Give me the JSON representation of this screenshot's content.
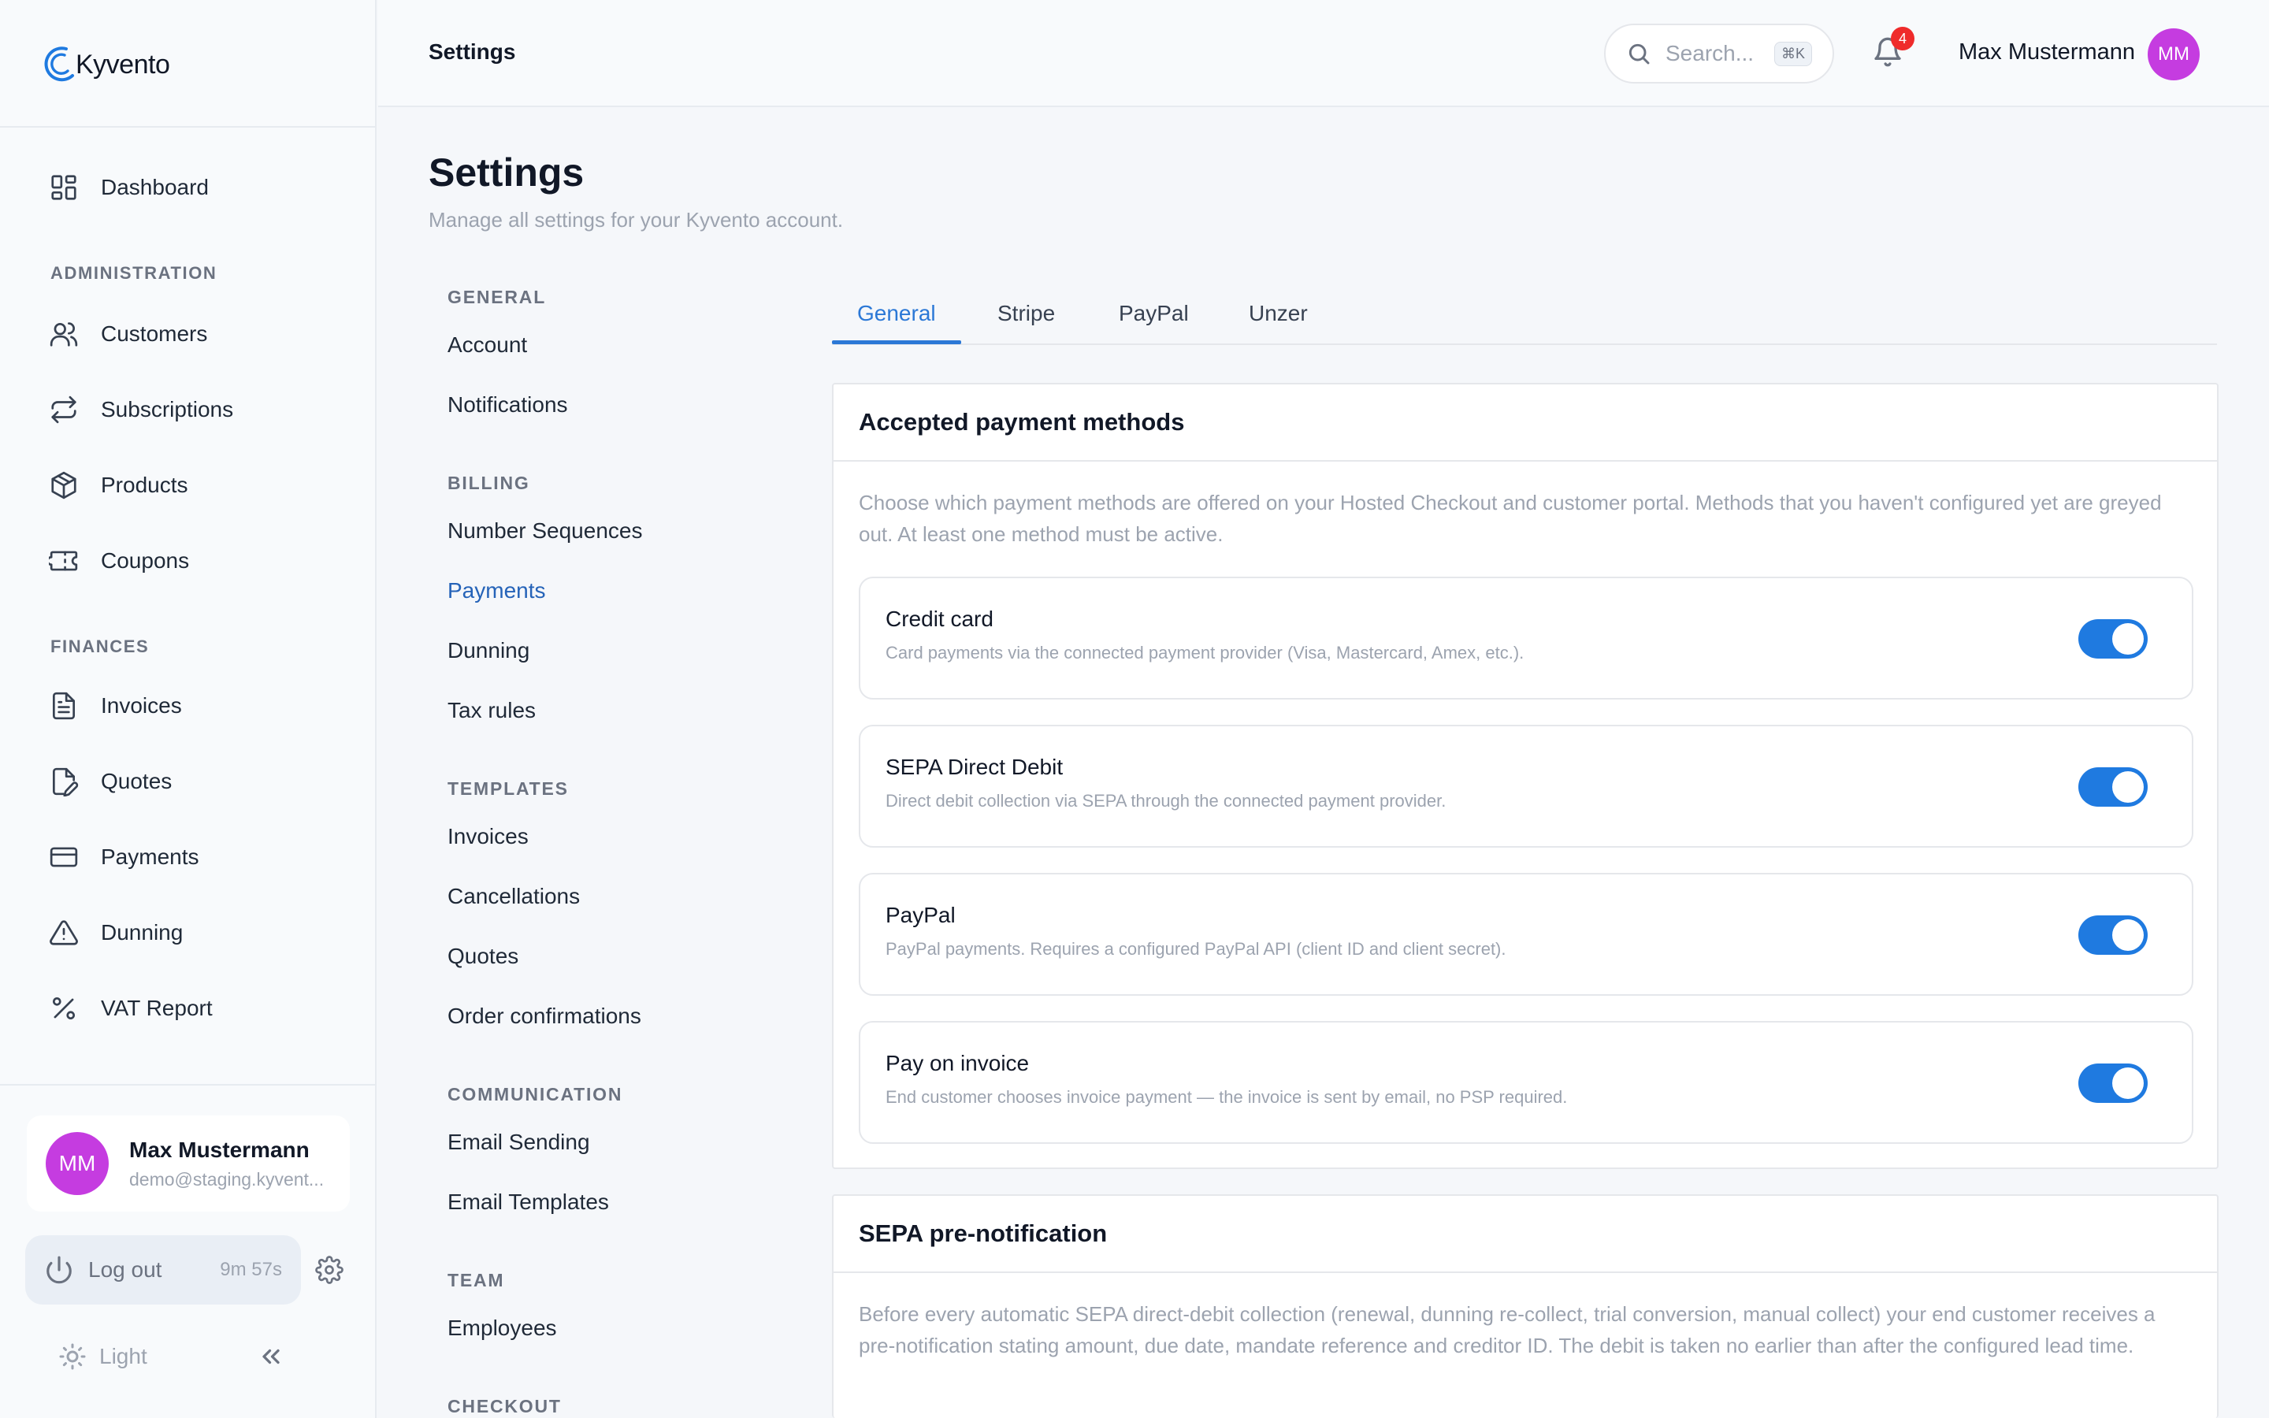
{
  "app": {
    "name": "Kyvento"
  },
  "sidebar": {
    "dashboard": "Dashboard",
    "sections": [
      {
        "label": "ADMINISTRATION",
        "items": [
          "Customers",
          "Subscriptions",
          "Products",
          "Coupons"
        ]
      },
      {
        "label": "FINANCES",
        "items": [
          "Invoices",
          "Quotes",
          "Payments",
          "Dunning",
          "VAT Report"
        ]
      }
    ],
    "user": {
      "initials": "MM",
      "name": "Max Mustermann",
      "email": "demo@staging.kyvent..."
    },
    "logout": {
      "label": "Log out",
      "timer": "9m 57s"
    },
    "theme": {
      "label": "Light"
    }
  },
  "topbar": {
    "title": "Settings",
    "search_placeholder": "Search...",
    "search_shortcut": "⌘K",
    "notification_count": "4",
    "user_name": "Max Mustermann",
    "user_initials": "MM"
  },
  "page": {
    "title": "Settings",
    "subtitle": "Manage all settings for your Kyvento account."
  },
  "settings_nav": [
    {
      "section": "GENERAL",
      "items": [
        "Account",
        "Notifications"
      ]
    },
    {
      "section": "BILLING",
      "items": [
        "Number Sequences",
        "Payments",
        "Dunning",
        "Tax rules"
      ]
    },
    {
      "section": "TEMPLATES",
      "items": [
        "Invoices",
        "Cancellations",
        "Quotes",
        "Order confirmations"
      ]
    },
    {
      "section": "COMMUNICATION",
      "items": [
        "Email Sending",
        "Email Templates"
      ]
    },
    {
      "section": "TEAM",
      "items": [
        "Employees"
      ]
    },
    {
      "section": "CHECKOUT",
      "items": []
    }
  ],
  "tabs": [
    "General",
    "Stripe",
    "PayPal",
    "Unzer"
  ],
  "payment_methods_card": {
    "title": "Accepted payment methods",
    "description": "Choose which payment methods are offered on your Hosted Checkout and customer portal. Methods that you haven't configured yet are greyed out. At least one method must be active.",
    "methods": [
      {
        "name": "Credit card",
        "description": "Card payments via the connected payment provider (Visa, Mastercard, Amex, etc.).",
        "enabled": true
      },
      {
        "name": "SEPA Direct Debit",
        "description": "Direct debit collection via SEPA through the connected payment provider.",
        "enabled": true
      },
      {
        "name": "PayPal",
        "description": "PayPal payments. Requires a configured PayPal API (client ID and client secret).",
        "enabled": true
      },
      {
        "name": "Pay on invoice",
        "description": "End customer chooses invoice payment — the invoice is sent by email, no PSP required.",
        "enabled": true
      }
    ]
  },
  "sepa_card": {
    "title": "SEPA pre-notification",
    "description": "Before every automatic SEPA direct-debit collection (renewal, dunning re-collect, trial conversion, manual collect) your end customer receives a pre-notification stating amount, due date, mandate reference and creditor ID. The debit is taken no earlier than after the configured lead time."
  },
  "colors": {
    "accent": "#2b78d6",
    "toggle_on": "#1f7ae0",
    "avatar": "#c53ce0",
    "badge": "#ef2b2b"
  }
}
